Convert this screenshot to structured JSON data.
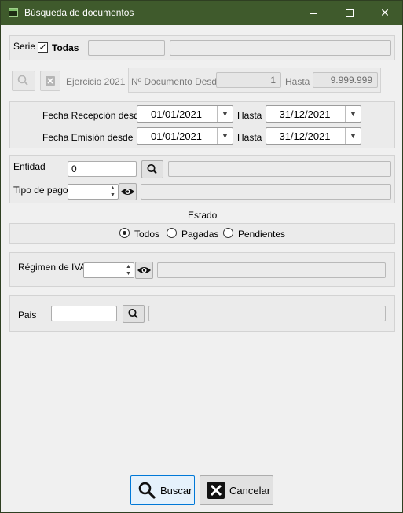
{
  "window": {
    "title": "Búsqueda de documentos",
    "minimize_icon": "minimize-icon",
    "maximize_icon": "maximize-icon",
    "close_glyph": "✕"
  },
  "serie": {
    "label": "Serie",
    "check_mark": "✓",
    "todas_label": "Todas",
    "code_value": "",
    "name_value": ""
  },
  "ejercicio": {
    "search_icon": "search-icon",
    "clear_icon": "clear-icon",
    "label": "Ejercicio 2021",
    "doc_desde_label": "Nº Documento Desde",
    "doc_desde_value": "1",
    "hasta_label": "Hasta",
    "hasta_value": "9.999.999"
  },
  "fechas": {
    "recepcion_label": "Fecha Recepción desde",
    "recepcion_desde": "01/01/2021",
    "recepcion_hasta_label": "Hasta",
    "recepcion_hasta": "31/12/2021",
    "emision_label": "Fecha Emisión desde",
    "emision_desde": "01/01/2021",
    "emision_hasta_label": "Hasta",
    "emision_hasta": "31/12/2021"
  },
  "entidad": {
    "label": "Entidad",
    "value": "0",
    "name_value": "",
    "tipo_pago_label": "Tipo de pago",
    "tipo_pago_value": "",
    "tipo_pago_desc": ""
  },
  "estado": {
    "label": "Estado",
    "options": [
      "Todos",
      "Pagadas",
      "Pendientes"
    ],
    "selected": "Todos"
  },
  "iva": {
    "label": "Régimen de IVA",
    "value": "",
    "desc": ""
  },
  "pais": {
    "label": "Pais",
    "value": "",
    "desc": ""
  },
  "actions": {
    "buscar_label": "Buscar",
    "cancelar_label": "Cancelar"
  },
  "colors": {
    "titlebar": "#3f5a2c",
    "focus": "#0078d7"
  }
}
